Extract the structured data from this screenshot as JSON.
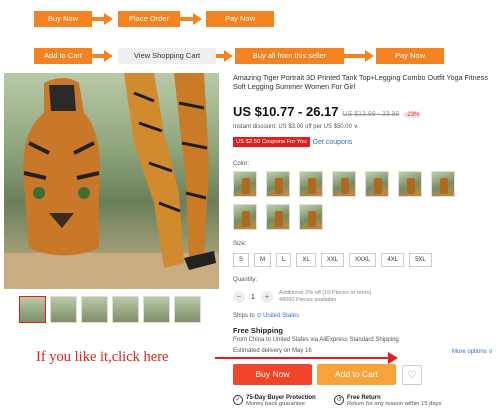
{
  "flow": {
    "row1": [
      "Buy Now",
      "Place Order",
      "Pay Now"
    ],
    "row2": [
      "Add to Cart",
      "View Shopping Cart",
      "Buy all from this seller",
      "Pay Now"
    ]
  },
  "product": {
    "title": "Amazing Tiger Portrait 3D Printed Tank Top+Legging Combo Outfit Yoga Fitness Soft Legging Summer Women For Girl",
    "price": "US $10.77 - 26.17",
    "old_price": "US $13.99 - 33.99",
    "discount": "-23%",
    "instant_discount": "Instant discount: US $3.00 off per US $50.00 ∨",
    "coupon_badge": "US $2.50 Coupons For You",
    "get_coupons": "Get coupons"
  },
  "options": {
    "color_label": "Color:",
    "size_label": "Size:",
    "sizes": [
      "S",
      "M",
      "L",
      "XL",
      "XXL",
      "XXXL",
      "4XL",
      "5XL"
    ],
    "quantity_label": "Quantity:",
    "quantity": "1",
    "quantity_note_1": "Additional 2% off (10 Pieces or more)",
    "quantity_note_2": "48000 Pieces available"
  },
  "shipping": {
    "ships_to_label": "Ships to",
    "ships_to": "United States",
    "free_shipping": "Free Shipping",
    "from": "From China to United States via AliExpress Standard Shipping",
    "estimated": "Estimated delivery on May 16",
    "more_options": "More options ∨"
  },
  "actions": {
    "buy_now": "Buy Now",
    "add_to_cart": "Add to Cart"
  },
  "guarantees": {
    "protection_title": "75-Day Buyer Protection",
    "protection_sub": "Money back guarantee",
    "return_title": "Free Return",
    "return_sub": "Return for any reason within 15 days"
  },
  "annotation": {
    "text": "If you like it,click here",
    "color": "#e02020"
  },
  "colors": {
    "accent_orange": "#f58220",
    "buy_now": "#f0452a",
    "add_to_cart": "#f8a23a",
    "link": "#2f6fcf"
  }
}
